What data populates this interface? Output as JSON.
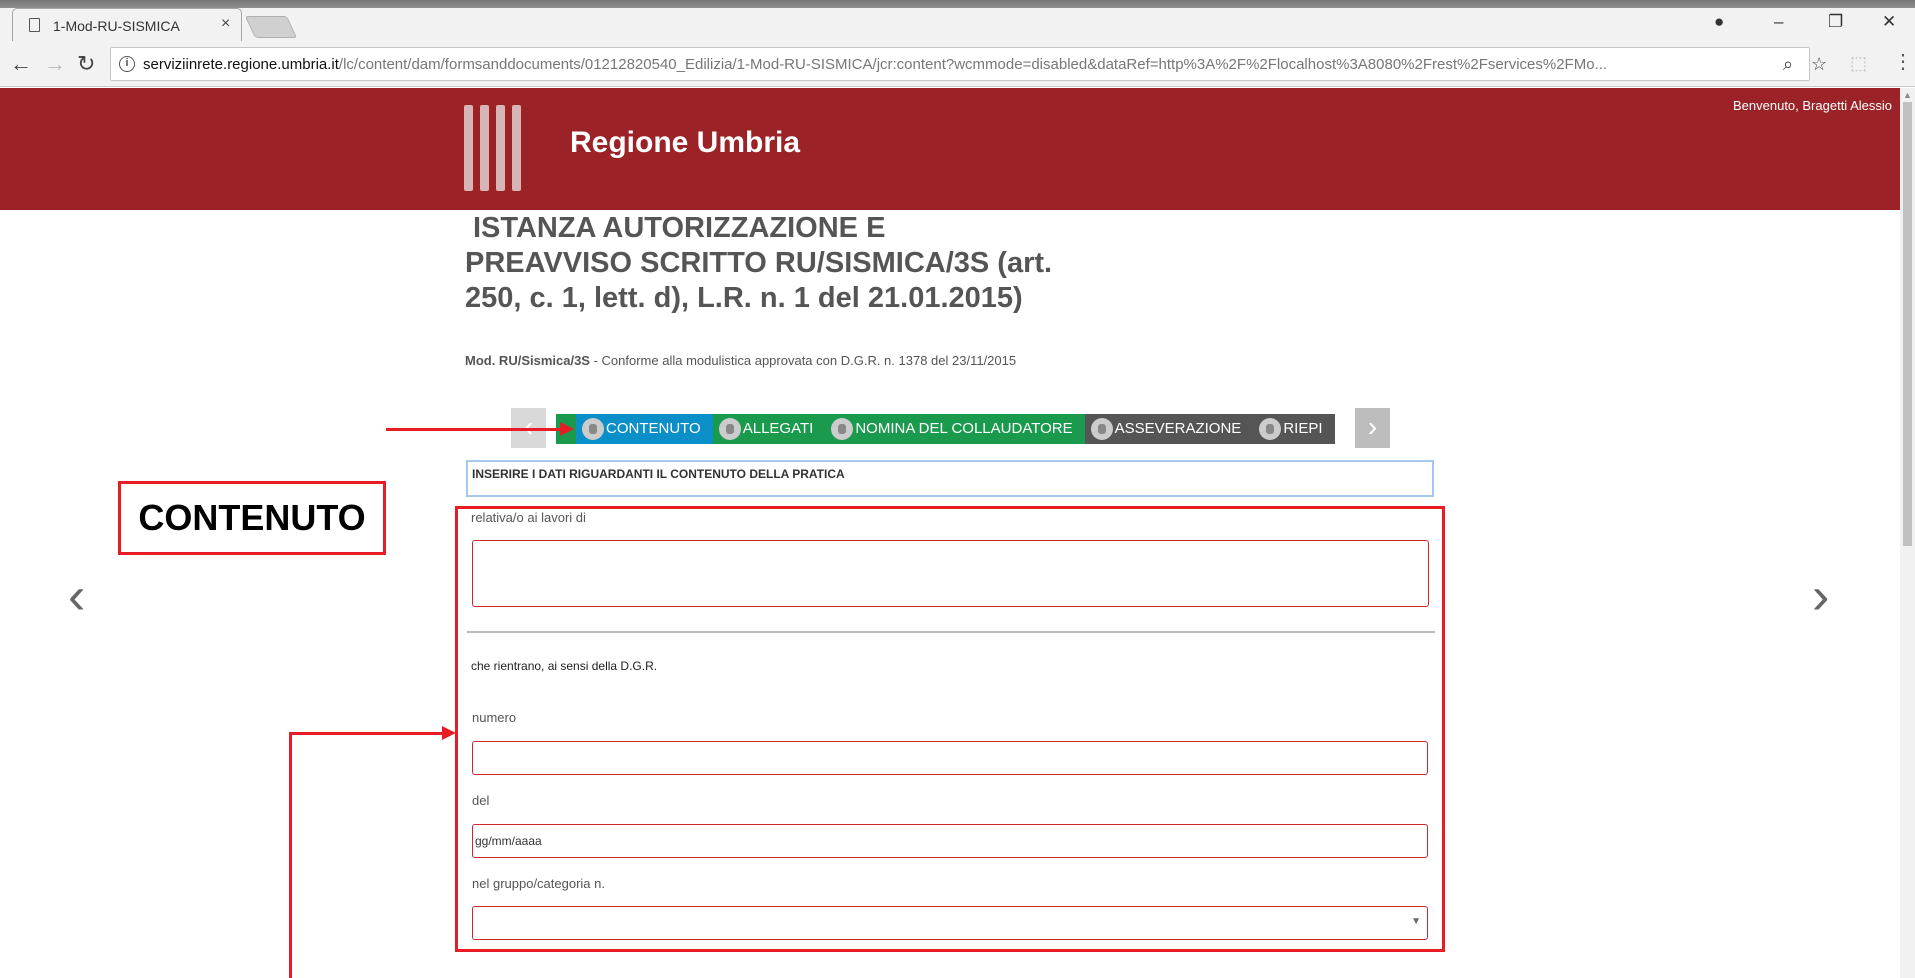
{
  "browser": {
    "tab_title": "1-Mod-RU-SISMICA",
    "tab_close": "×",
    "url_host": "serviziinrete.regione.umbria.it",
    "url_path": "/lc/content/dam/formsanddocuments/01212820540_Edilizia/1-Mod-RU-SISMICA/jcr:content?wcmmode=disabled&dataRef=http%3A%2F%2Flocalhost%3A8080%2Frest%2Fservices%2FMo..."
  },
  "header": {
    "brand": "Regione Umbria",
    "welcome": "Benvenuto, Bragetti Alessio"
  },
  "page": {
    "title_line1": "ISTANZA AUTORIZZAZIONE E",
    "title_line2": "PREAVVISO SCRITTO RU/SISMICA/3S (art.",
    "title_line3": "250, c. 1, lett. d), L.R. n. 1 del 21.01.2015)",
    "subtitle_bold": "Mod. RU/Sismica/3S",
    "subtitle_rest": " - Conforme alla modulistica approvata con D.G.R. n. 1378 del  23/11/2015"
  },
  "steps": [
    {
      "label": "CONTENUTO",
      "state": "active"
    },
    {
      "label": "ALLEGATI",
      "state": "done"
    },
    {
      "label": "NOMINA DEL COLLAUDATORE",
      "state": "done"
    },
    {
      "label": "ASSEVERAZIONE",
      "state": "pending"
    },
    {
      "label": "RIEPI",
      "state": "pending"
    }
  ],
  "info_box": "INSERIRE I DATI RIGUARDANTI IL CONTENUTO DELLA PRATICA",
  "form": {
    "lavori_label": "relativa/o ai lavori di",
    "rientrano_label": "che rientrano, ai sensi della D.G.R.",
    "numero_label": "numero",
    "del_label": "del",
    "del_value": "gg/mm/aaaa",
    "gruppo_label": "nel gruppo/categoria n."
  },
  "annotation": {
    "callout": "CONTENUTO"
  },
  "colors": {
    "header_bg": "#9b2227",
    "annotation_red": "#e81c24",
    "step_green": "#1a9a4c",
    "step_active": "#0a8fc9",
    "step_grey": "#555555"
  }
}
